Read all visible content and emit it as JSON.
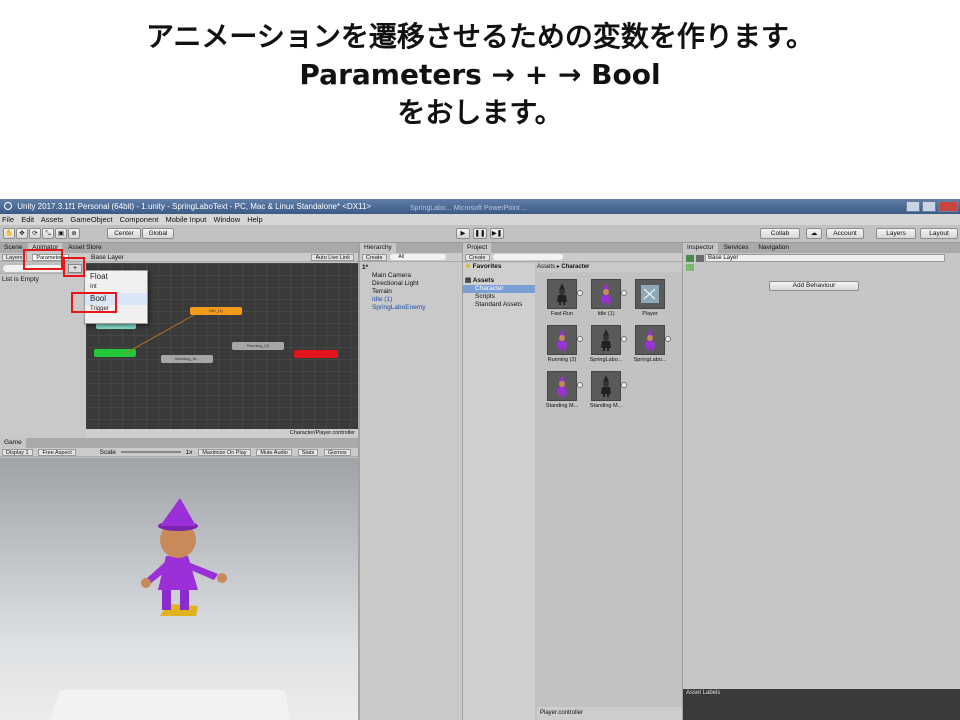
{
  "slide": {
    "line1": "アニメーションを遷移させるための変数を作ります。",
    "line2": "Parameters → + → Bool",
    "line3": "をおします。"
  },
  "window": {
    "title": "Unity 2017.3.1f1 Personal (64bit) - 1.unity - SpringLaboText - PC, Mac & Linux Standalone* <DX11>",
    "background_tabs": "SpringLabo...  Microsoft PowerPoint ..."
  },
  "menu": [
    "File",
    "Edit",
    "Assets",
    "GameObject",
    "Component",
    "Mobile Input",
    "Window",
    "Help"
  ],
  "toolbar": {
    "center": "Center",
    "global": "Global",
    "collab": "Collab",
    "account": "Account",
    "layers": "Layers",
    "layout": "Layout"
  },
  "animator": {
    "tab_scene": "Scene",
    "tab_animator": "Animator",
    "tab_asset_store": "Asset Store",
    "btn_layers": "Layers",
    "btn_parameters": "Parameters",
    "base_layer": "Base Layer",
    "auto_live_link": "Auto Live Link",
    "list_empty": "List is Empty",
    "footer": "Character/Player.controller",
    "dropdown": [
      "Float",
      "Int",
      "Bool",
      "Trigger"
    ],
    "states": {
      "orange": "Idle_(1)",
      "gray1": "Running_(2)",
      "gray2": "Standing_M..."
    }
  },
  "game": {
    "tab": "Game",
    "display": "Display 1",
    "aspect": "Free Aspect",
    "scale": "Scale",
    "scale_value": "1x",
    "maximize": "Maximize On Play",
    "mute": "Mute Audio",
    "stats": "Stats",
    "gizmos": "Gizmos"
  },
  "hierarchy": {
    "tab": "Hierarchy",
    "create": "Create",
    "search": "All",
    "scene": "1*",
    "items": [
      "Main Camera",
      "Directional Light",
      "Terrain",
      "Idle (1)",
      "SpringLaboEnemy"
    ]
  },
  "project": {
    "tab": "Project",
    "create": "Create",
    "favorites": "Favorites",
    "assets": "Assets",
    "tree": [
      "Character",
      "Scripts",
      "Standard Assets"
    ],
    "breadcrumb_root": "Assets",
    "breadcrumb_sep": "▸",
    "breadcrumb_leaf": "Character",
    "items": [
      "Fast Run",
      "Idle (1)",
      "Player",
      "Running (2)",
      "SpringLabo...",
      "SpringLabo...",
      "Standing M...",
      "Standing M..."
    ],
    "footer": "Player.controller"
  },
  "inspector": {
    "tab": "Inspector",
    "tab_services": "Services",
    "tab_navigation": "Navigation",
    "base_layer": "Base Layer",
    "add_behaviour": "Add Behaviour",
    "asset_labels": "Asset Labels"
  },
  "colors": {
    "highlight": "#e8161b",
    "hat": "#9b30d8",
    "state_orange": "#f39a1b",
    "state_green": "#23c93a",
    "state_red": "#e0141a"
  }
}
